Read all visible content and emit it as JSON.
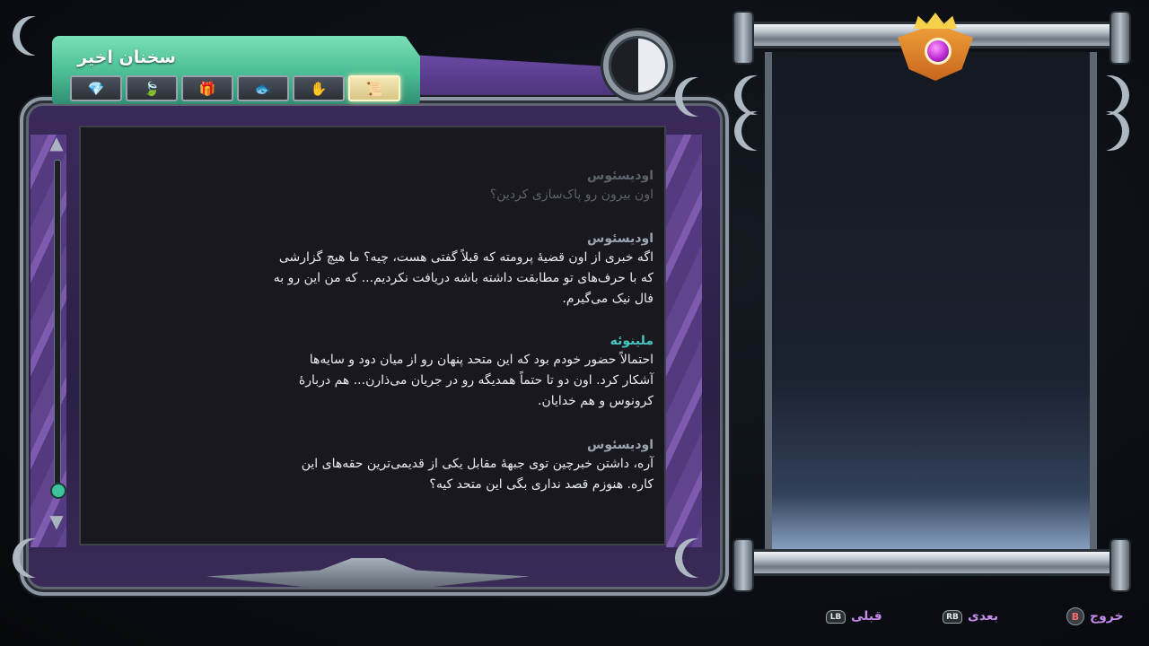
{
  "codex": {
    "title": "سخنان اخیر",
    "tabs": [
      {
        "icon": "gem-icon",
        "glyph": "💎"
      },
      {
        "icon": "leaf-icon",
        "glyph": "🍃"
      },
      {
        "icon": "gift-icon",
        "glyph": "🎁"
      },
      {
        "icon": "fish-icon",
        "glyph": "🐟"
      },
      {
        "icon": "hand-icon",
        "glyph": "✋"
      },
      {
        "icon": "scroll-icon",
        "glyph": "📜"
      }
    ],
    "active_tab": 5
  },
  "dialogue": [
    {
      "speaker": "اودیسئوس",
      "lines": [
        "اون بیرون رو پاک‌سازی کردین؟"
      ],
      "faded": true
    },
    {
      "speaker": "اودیسئوس",
      "lines": [
        "اگه خبری از اون قضیهٔ پرومته که قبلاً گفتی هست، چیه؟ ما هیچ گزارشی",
        "که با حرف‌های تو مطابقت داشته باشه دریافت نکردیم... که من این رو به",
        "فال نیک می‌گیرم."
      ]
    },
    {
      "speaker": "ملینوئه",
      "lines": [
        "احتمالاً حضور خودم بود که این متحد پنهان رو از میان دود و سایه‌ها",
        "آشکار کرد. اون دو تا حتماً همدیگه رو در جریان می‌ذارن... هم دربارهٔ",
        "کرونوس و هم خدایان."
      ]
    },
    {
      "speaker": "اودیسئوس",
      "lines": [
        "آره، داشتن خبرچین توی جبههٔ مقابل یکی از قدیمی‌ترین حقه‌های این",
        "کاره. هنوزم قصد نداری بگی این متحد کیه؟"
      ]
    }
  ],
  "footer": {
    "previous": {
      "label": "قبلی",
      "button": "LB"
    },
    "next": {
      "label": "بعدی",
      "button": "RB"
    },
    "exit": {
      "label": "خروج",
      "button": "B"
    }
  },
  "colors": {
    "speaker_default": "#9aa5b1",
    "speaker_melinoe": "#48c4c1",
    "hint_label": "#c38bea",
    "banner_green": "#4bbd94",
    "frame_purple": "#2a1f45"
  }
}
